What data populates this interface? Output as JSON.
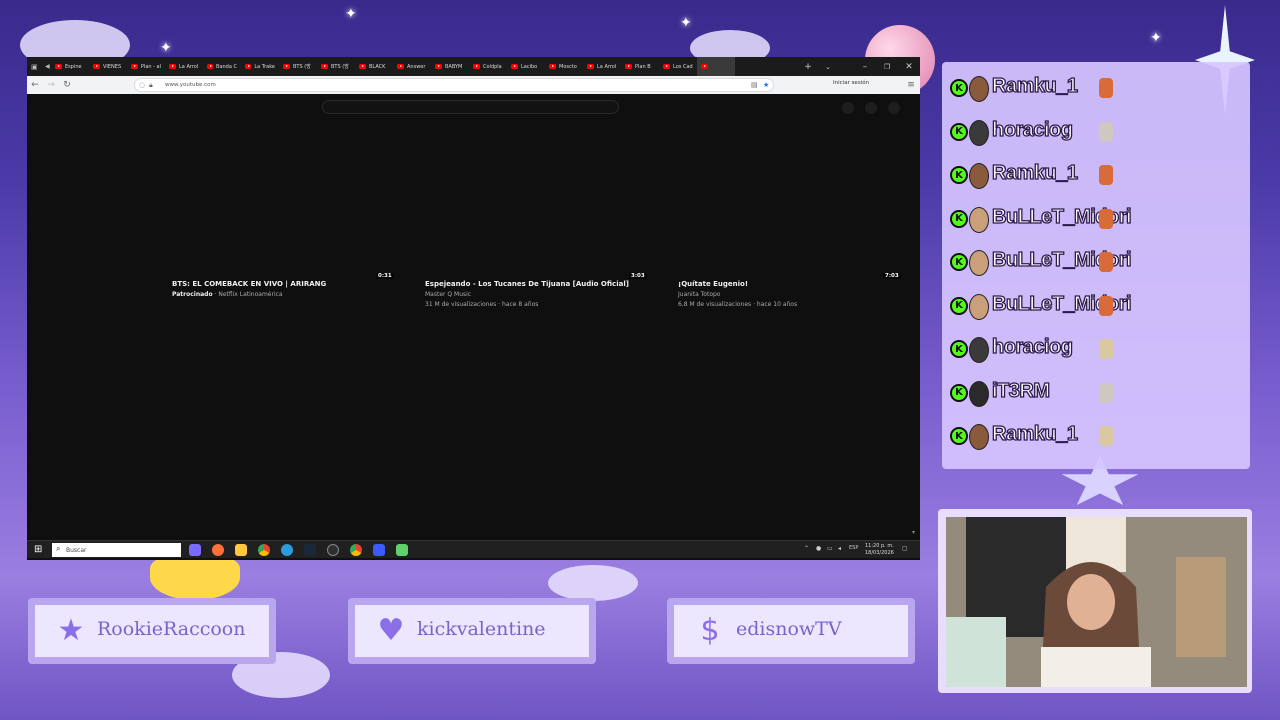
{
  "browser": {
    "tabs": [
      {
        "label": "Espine",
        "yt": true
      },
      {
        "label": "VIENES",
        "yt": true
      },
      {
        "label": "Plan - al",
        "yt": true
      },
      {
        "label": "La Arrol",
        "yt": true
      },
      {
        "label": "Banda C",
        "yt": true
      },
      {
        "label": "La Trake",
        "yt": true
      },
      {
        "label": "BTS (방",
        "yt": true
      },
      {
        "label": "BTS (방",
        "yt": true
      },
      {
        "label": "BLACK",
        "yt": true
      },
      {
        "label": "Answer",
        "yt": true
      },
      {
        "label": "BABYM",
        "yt": true
      },
      {
        "label": "Coldpla",
        "yt": true
      },
      {
        "label": "Lacibo",
        "yt": true
      },
      {
        "label": "Moscto",
        "yt": true
      },
      {
        "label": "La Arrol",
        "yt": true
      },
      {
        "label": "Plan B",
        "yt": true
      },
      {
        "label": "Los Cad",
        "yt": true
      },
      {
        "label": "",
        "yt": true
      }
    ],
    "url": "www.youtube.com",
    "signin": "Iniciar sesión"
  },
  "videos": [
    {
      "duration": "0:31",
      "title": "BTS: EL COMEBACK EN VIVO | ARIRANG",
      "channel": "Netflix Latinoamérica",
      "sponsored": "Patrocinado",
      "stats": ""
    },
    {
      "duration": "3:03",
      "title": "Espejeando - Los Tucanes De Tijuana [Audio Oficial]",
      "channel": "Master Q Music",
      "sponsored": "",
      "stats": "31 M de visualizaciones · hace 8 años"
    },
    {
      "duration": "7:03",
      "title": "¡Quítate Eugenio!",
      "channel": "Juanita Totopo",
      "sponsored": "",
      "stats": "6,8 M de visualizaciones · hace 10 años"
    }
  ],
  "taskbar": {
    "search_placeholder": "Buscar",
    "time": "11:20 p. m.",
    "date": "18/03/2026",
    "lang": "ESP"
  },
  "chat": {
    "messages": [
      {
        "user": "Ramku_1",
        "avatar_color": "#8a5a3c",
        "emote_color": "#d96b3a"
      },
      {
        "user": "horaciog",
        "avatar_color": "#3a3a3a",
        "emote_color": "#cfc8c0"
      },
      {
        "user": "Ramku_1",
        "avatar_color": "#8a5a3c",
        "emote_color": "#d96b3a"
      },
      {
        "user": "BuLLeT_Midori",
        "avatar_color": "#caa07a",
        "emote_color": "#d96b3a"
      },
      {
        "user": "BuLLeT_Midori",
        "avatar_color": "#caa07a",
        "emote_color": "#d96b3a"
      },
      {
        "user": "BuLLeT_Midori",
        "avatar_color": "#caa07a",
        "emote_color": "#d96b3a"
      },
      {
        "user": "horaciog",
        "avatar_color": "#3a3a3a",
        "emote_color": "#d9c9a0"
      },
      {
        "user": "iT3RM",
        "avatar_color": "#2a2a2a",
        "emote_color": "#cfc8c0"
      },
      {
        "user": "Ramku_1",
        "avatar_color": "#8a5a3c",
        "emote_color": "#d9c9a0"
      }
    ]
  },
  "socials": [
    {
      "icon": "star-icon",
      "glyph": "★",
      "name": "RookieRaccoon"
    },
    {
      "icon": "heart-icon",
      "glyph": "♥",
      "name": "kickvalentine"
    },
    {
      "icon": "dollar-icon",
      "glyph": "$",
      "name": "edisnowTV"
    }
  ],
  "colors": {
    "kick_green": "#53fc18",
    "panel_purple": "#b9a6ee",
    "youtube_red": "#ff0000"
  }
}
